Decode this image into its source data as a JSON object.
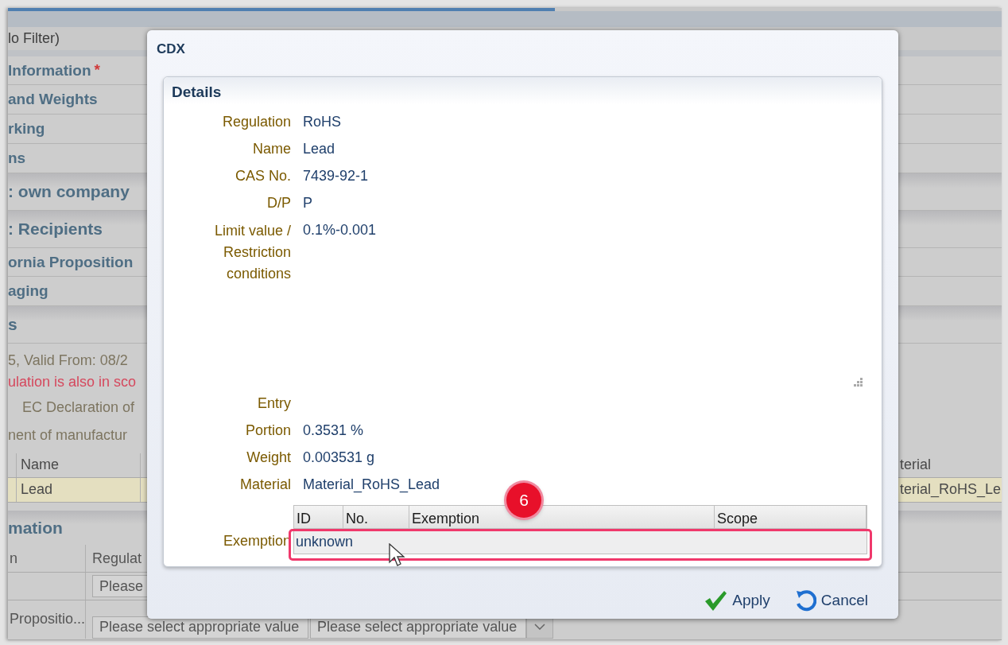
{
  "filter": {
    "value": "lo Filter)"
  },
  "sections": [
    {
      "label": "Information",
      "kind": "item",
      "required_mark": "*"
    },
    {
      "label": "and Weights",
      "kind": "item"
    },
    {
      "label": "rking",
      "kind": "item"
    },
    {
      "label": "ns",
      "kind": "item"
    },
    {
      "label": ": own company",
      "kind": "header"
    },
    {
      "label": ": Recipients",
      "kind": "header"
    },
    {
      "label": "ornia Proposition",
      "kind": "item"
    },
    {
      "label": "aging",
      "kind": "item"
    },
    {
      "label": "s",
      "kind": "header"
    }
  ],
  "info_lines": [
    {
      "text": "5, Valid From: 08/2",
      "kind": "normal"
    },
    {
      "text": "ulation is also in sco",
      "kind": "warning"
    },
    {
      "text": "EC Declaration of",
      "kind": "indent"
    },
    {
      "text": "nent of manufactur",
      "kind": "normal"
    }
  ],
  "substances_table": {
    "columns": [
      "Name",
      "terial"
    ],
    "rows": [
      {
        "cells": [
          "Lead",
          "terial_RoHS_Le"
        ],
        "selected": true
      }
    ]
  },
  "info_header": "mation",
  "regulation_table": {
    "columns": [
      "n",
      "Regulat"
    ],
    "rows": [
      {
        "cells": [
          "",
          "Please"
        ]
      },
      {
        "cells": [
          "Propositio...",
          "Please select appropriate value",
          "Please select appropriate value"
        ]
      }
    ]
  },
  "dialog": {
    "title": "CDX",
    "panel_title": "Details",
    "fields": [
      {
        "label": "Regulation",
        "value": "RoHS",
        "kind": "text"
      },
      {
        "label": "Name",
        "value": "Lead",
        "kind": "text"
      },
      {
        "label": "CAS No.",
        "value": "7439-92-1",
        "kind": "text"
      },
      {
        "label": "D/P",
        "value": "P",
        "kind": "text"
      },
      {
        "label": "Limit value / Restriction conditions",
        "value": "0.1%-0.001",
        "kind": "area"
      },
      {
        "label": "Entry",
        "kind": "text"
      },
      {
        "label": "Portion",
        "value": "0.3531 %",
        "kind": "text"
      },
      {
        "label": "Weight",
        "value": "0.003531 g",
        "kind": "text"
      },
      {
        "label": "Material",
        "value": "Material_RoHS_Lead",
        "kind": "text"
      }
    ],
    "exemption": {
      "label": "Exemption",
      "columns": [
        "ID",
        "No.",
        "Exemption",
        "Scope"
      ],
      "rows": [
        "unknown"
      ],
      "badge": "6"
    },
    "buttons": [
      {
        "label": "Apply",
        "kind": "apply"
      },
      {
        "label": "Cancel",
        "kind": "cancel"
      }
    ]
  }
}
